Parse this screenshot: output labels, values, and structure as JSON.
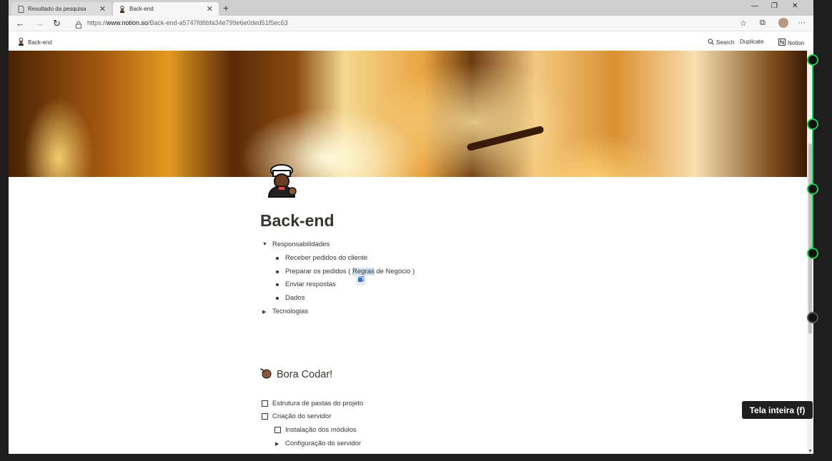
{
  "browser": {
    "tabs": [
      {
        "title": "Resultado da pesquisa",
        "active": false,
        "icon": "page-icon"
      },
      {
        "title": "Back-end",
        "active": true,
        "icon": "chef-icon"
      }
    ],
    "url_scheme": "https://",
    "url_host": "www.notion.so",
    "url_path": "/Back-end-a5747fd6bfa34e799e6e0ded51f5ec63"
  },
  "notion": {
    "breadcrumb": "Back-end",
    "search_label": "Search",
    "duplicate_label": "Duplicate",
    "notion_label": "Notion"
  },
  "page": {
    "title": "Back-end",
    "toggle1": {
      "label": "Responsabilidades",
      "items": [
        "Receber pedidos do cliente",
        "Dados"
      ],
      "item2_pre": "Preparar os pedidos ( ",
      "item2_hl": "Regras",
      "item2_post": " de Negócio )",
      "item3": "Enviar respostas"
    },
    "toggle2": "Tecnologias",
    "heading": "Bora Codar!",
    "todos": [
      "Estrutura de pastas do projeto",
      "Criação do servidor",
      "Instalação dos módulos"
    ],
    "toggle3": "Configuração do servidor"
  },
  "tooltip": "Tela inteira (f)",
  "colors": {
    "timeline_green": "#1fca56",
    "text": "#37352f"
  }
}
